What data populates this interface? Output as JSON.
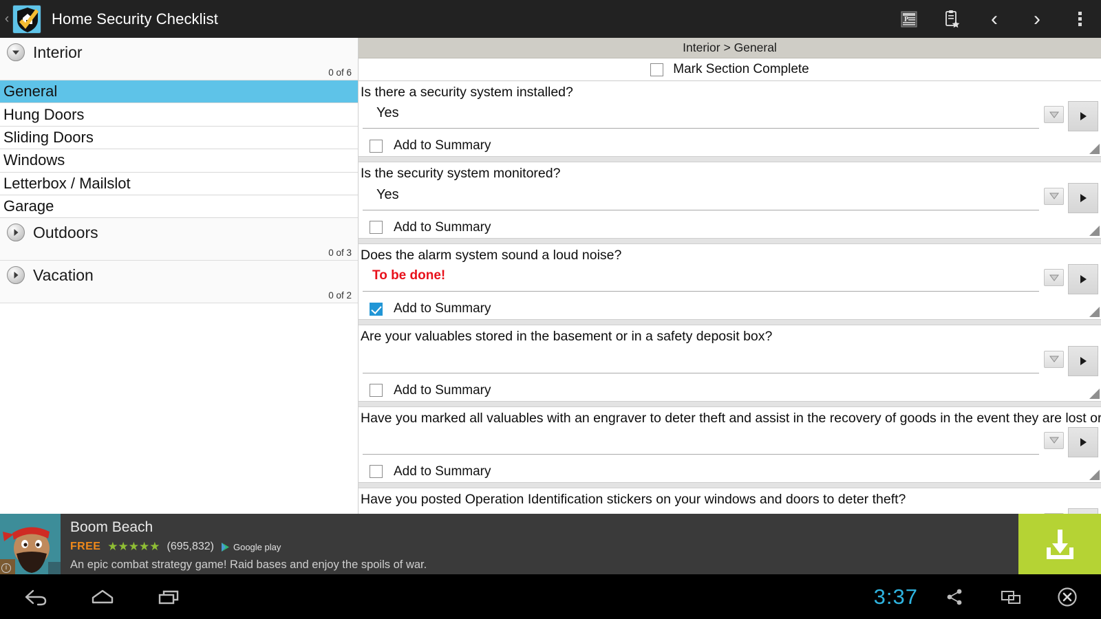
{
  "appbar": {
    "back_label": "‹",
    "title": "Home Security Checklist",
    "actions": [
      {
        "name": "pdf-export-icon",
        "label": "P"
      },
      {
        "name": "clipboard-star-icon",
        "label": ""
      },
      {
        "name": "previous-icon",
        "label": "‹"
      },
      {
        "name": "next-icon",
        "label": "›"
      },
      {
        "name": "overflow-menu-icon",
        "label": ""
      }
    ]
  },
  "sidebar": {
    "groups": [
      {
        "title": "Interior",
        "count": "0 of 6",
        "expanded": true,
        "items": [
          {
            "label": "General",
            "selected": true
          },
          {
            "label": "Hung Doors",
            "selected": false
          },
          {
            "label": "Sliding Doors",
            "selected": false
          },
          {
            "label": "Windows",
            "selected": false
          },
          {
            "label": "Letterbox / Mailslot",
            "selected": false
          },
          {
            "label": "Garage",
            "selected": false
          }
        ]
      },
      {
        "title": "Outdoors",
        "count": "0 of 3",
        "expanded": false,
        "items": []
      },
      {
        "title": "Vacation",
        "count": "0 of 2",
        "expanded": false,
        "items": []
      }
    ]
  },
  "main": {
    "breadcrumb": "Interior > General",
    "mark_section_complete": {
      "label": "Mark Section Complete",
      "checked": false
    },
    "summary_label": "Add to Summary",
    "questions": [
      {
        "question": "Is there a security system installed?",
        "answer": "Yes",
        "answer_style": "normal",
        "add_to_summary": false
      },
      {
        "question": "Is the security system monitored?",
        "answer": "Yes",
        "answer_style": "normal",
        "add_to_summary": false
      },
      {
        "question": "Does the alarm system sound a loud noise?",
        "answer": "To be done!",
        "answer_style": "todo",
        "add_to_summary": true
      },
      {
        "question": "Are your valuables stored in the basement or in a safety deposit box?",
        "answer": "",
        "answer_style": "normal",
        "add_to_summary": false
      },
      {
        "question": "Have you marked all valuables with an engraver to deter theft and assist in the recovery of goods in the event they are lost or stolen?",
        "answer": "",
        "answer_style": "normal",
        "add_to_summary": false
      },
      {
        "question": "Have you posted Operation Identification stickers on your windows and doors to deter theft?",
        "answer": "",
        "answer_style": "normal",
        "add_to_summary": false
      }
    ]
  },
  "ad": {
    "title": "Boom Beach",
    "price": "FREE",
    "stars": "★★★★★",
    "rating_count": "(695,832)",
    "store": "Google play",
    "description": "An epic combat strategy game! Raid bases and enjoy the spoils of war.",
    "download_icon": "download-icon"
  },
  "navbar": {
    "back_icon": "back-icon",
    "home_icon": "home-icon",
    "recents_icon": "recent-apps-icon",
    "clock": "3:37",
    "share_icon": "share-icon",
    "cast_icon": "cast-icon",
    "close_icon": "close-icon"
  },
  "colors": {
    "accent_blue": "#5ec3e8",
    "appbar": "#222222",
    "todo_red": "#e8111b",
    "ad_green": "#b5d334",
    "clock_cyan": "#2fb4e0",
    "breadcrumb_band": "#cfcdc6"
  }
}
